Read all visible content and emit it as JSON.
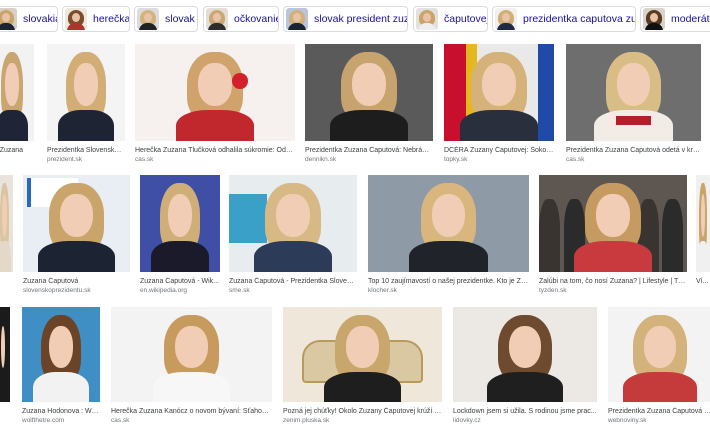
{
  "chips": [
    {
      "label": "slovakia",
      "hair": "#c9a56a",
      "bg": "#d8d0c4",
      "body": "#1c2333"
    },
    {
      "label": "herečka",
      "hair": "#7a4e2c",
      "bg": "#efe6dc",
      "body": "#b0342b"
    },
    {
      "label": "slovak",
      "hair": "#d2b57d",
      "bg": "#dcdce0",
      "body": "#222"
    },
    {
      "label": "očkovanie",
      "hair": "#caa874",
      "bg": "#e5ded6",
      "body": "#2d2d2d"
    },
    {
      "label": "slovak president zuzana",
      "hair": "#d1b079",
      "bg": "#b9c5dd",
      "body": "#1c2333"
    },
    {
      "label": "čaputovej",
      "hair": "#c9a56a",
      "bg": "#e3e1de",
      "body": "#eee"
    },
    {
      "label": "prezidentka caputova zuzana",
      "hair": "#cfae78",
      "bg": "#f2f0ee",
      "body": "#1e2a44"
    },
    {
      "label": "moderátor",
      "hair": "#5b3a22",
      "bg": "#d9d3cc",
      "body": "#111"
    }
  ],
  "rows": [
    [
      {
        "caption": "ng Zuzana",
        "source": "",
        "bg": "#f2f2f2",
        "hair": "#c9a670",
        "body": "#1f2436",
        "extra": ""
      },
      {
        "caption": "Prezidentka Slovenskej ...",
        "source": "prezident.sk",
        "bg": "#f4f4f4",
        "hair": "#d2ae76",
        "body": "#1e2433",
        "extra": ""
      },
      {
        "caption": "Herečka Zuzana Tlučková odhalila súkromie: Odpo...",
        "source": "cas.sk",
        "bg": "#f6f1ee",
        "hair": "#cfa36b",
        "body": "#c0282d",
        "extra": "flower"
      },
      {
        "caption": "Prezidentka Zuzana Čaputová: Nebráni...",
        "source": "dennikn.sk",
        "bg": "#5a5a5a",
        "hair": "#c7a36e",
        "body": "#1d1d1d",
        "extra": ""
      },
      {
        "caption": "DCÉRA Zuzany Čaputovej: Šokovaní...",
        "source": "topky.sk",
        "bg": "#e9e9e9",
        "hair": "#d5b27a",
        "body": "#2a2f3d",
        "extra": "flags"
      },
      {
        "caption": "Prezidentka Zuzana Čaputová odetá v kroji...",
        "source": "cas.sk",
        "bg": "#6e6e6e",
        "hair": "#d9bd87",
        "body": "#f1ece6",
        "extra": "kroj"
      }
    ],
    [
      {
        "caption": "",
        "source": "",
        "bg": "#e9e3dc",
        "hair": "#d9c5a3",
        "body": "#e4d8c8",
        "extra": ""
      },
      {
        "caption": "Zuzana Čaputová",
        "source": "slovenskoprezidentu.sk",
        "bg": "#e8eef4",
        "hair": "#caa56b",
        "body": "#1c2333",
        "extra": "vakcina"
      },
      {
        "caption": "Zuzana Čaputová - Wik...",
        "source": "en.wikipedia.org",
        "bg": "#3f4fa6",
        "hair": "#cfae78",
        "body": "#1a1a2a",
        "extra": ""
      },
      {
        "caption": "Zuzana Čaputová - Prezidentka Slovens...",
        "source": "sme.sk",
        "bg": "#e7ecef",
        "hair": "#d6b985",
        "body": "#2c3b58",
        "extra": "tc"
      },
      {
        "caption": "Top 10 zaujímavostí o našej prezidentke. Kto je Zu...",
        "source": "klocher.sk",
        "bg": "#8e9aa6",
        "hair": "#d8b67d",
        "body": "#21232b",
        "extra": ""
      },
      {
        "caption": "Zalúbi na tom, čo nosí Zuzana? | Lifestyle | Týž...",
        "source": "tyzden.sk",
        "bg": "#5e5650",
        "hair": "#c69b62",
        "body": "#c93a3f",
        "extra": "crowd"
      },
      {
        "caption": "Ví...",
        "source": "",
        "bg": "#f0f0f0",
        "hair": "#c9a56a",
        "body": "#f0f0f0",
        "extra": ""
      }
    ],
    [
      {
        "caption": "",
        "source": "",
        "bg": "#1b1b1b",
        "hair": "#1b1b1b",
        "body": "#1b1b1b",
        "extra": ""
      },
      {
        "caption": "Zuzana Hodonova : Wo...",
        "source": "wolfthetre.com",
        "bg": "#3f8fc4",
        "hair": "#6b4427",
        "body": "#f2f2f2",
        "extra": ""
      },
      {
        "caption": "Herečka Zuzana Kanócz o novom bývaní: Sťahovať...",
        "source": "cas.sk",
        "bg": "#f3f3f3",
        "hair": "#c79a5e",
        "body": "#f7f7f7",
        "extra": ""
      },
      {
        "caption": "Pozná jej chúťky! Okolo Zuzany Čaputovej krúží da...",
        "source": "zenim.pluska.sk",
        "bg": "#efe8da",
        "hair": "#c9a66c",
        "body": "#1e1e1e",
        "extra": "sofa"
      },
      {
        "caption": "Lockdown jsem si užila. S rodinou jsme prac...",
        "source": "lidovky.cz",
        "bg": "#ece8e4",
        "hair": "#6e4a2f",
        "body": "#1f1f1f",
        "extra": ""
      },
      {
        "caption": "Prezidentka Zuzana Čaputová sa bude prípra...",
        "source": "webnoviny.sk",
        "bg": "#f3f3f3",
        "hair": "#d3b27c",
        "body": "#c53a3a",
        "extra": ""
      }
    ]
  ]
}
